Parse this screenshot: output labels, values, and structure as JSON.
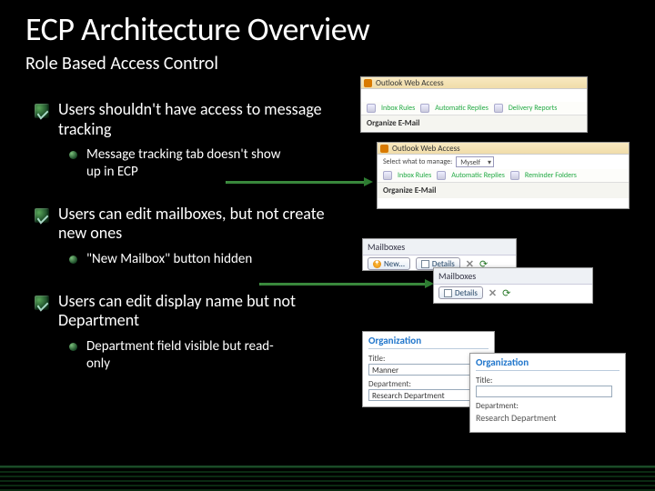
{
  "title": "ECP Architecture Overview",
  "subtitle": "Role Based Access Control",
  "owa_brand": "Outlook Web Access",
  "points": [
    {
      "main": "Users shouldn't have access to message tracking",
      "sub": "Message tracking tab doesn't show up in ECP"
    },
    {
      "main": "Users can edit mailboxes, but not create new ones",
      "sub": "\"New Mailbox\" button hidden"
    },
    {
      "main": "Users can edit display name but not Department",
      "sub": "Department field visible but read-only"
    }
  ],
  "thumbs": {
    "owa1": {
      "organize_label": "Organize E-Mail",
      "tabs": [
        "Inbox Rules",
        "Automatic Replies",
        "Delivery Reports"
      ]
    },
    "owa2": {
      "select_label": "Select what to manage:",
      "select_value": "Myself",
      "organize_label": "Organize E-Mail",
      "tabs": [
        "Inbox Rules",
        "Automatic Replies",
        "Reminder Folders"
      ]
    },
    "mb1": {
      "header": "Mailboxes",
      "new_label": "New…",
      "details_label": "Details"
    },
    "mb2": {
      "header": "Mailboxes",
      "details_label": "Details"
    },
    "org1": {
      "header": "Organization",
      "title_label": "Title:",
      "title_value": "Manner",
      "dept_label": "Department:",
      "dept_value": "Research Department"
    },
    "org2": {
      "header": "Organization",
      "title_label": "Title:",
      "title_value": "",
      "dept_label": "Department:",
      "dept_value": "Research Department"
    }
  }
}
